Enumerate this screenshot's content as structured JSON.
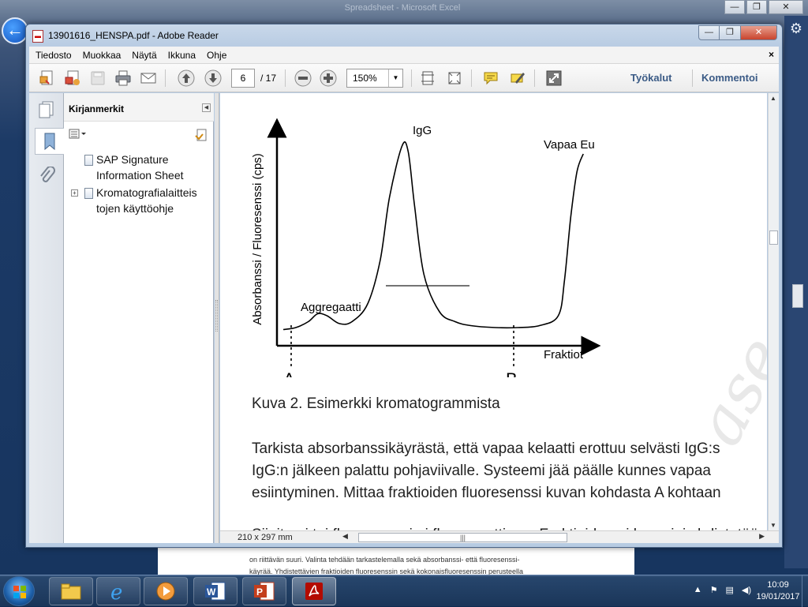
{
  "background": {
    "window_title": "Spreadsheet - Microsoft Excel",
    "peek_doc_lines": [
      "on riittävän suuri. Valinta tehdään tarkastelemalla sekä absorbanssi- että fluoresenssi-",
      "käyrää. Yhdistettävien fraktioiden fluoresenssin sekä kokonaisfluoresenssin perusteella"
    ]
  },
  "window": {
    "title": "13901616_HENSPA.pdf - Adobe Reader",
    "icon_name": "pdf-file-icon",
    "buttons": {
      "minimize": "—",
      "maximize": "❐",
      "close": "✕"
    }
  },
  "menubar": {
    "items": [
      "Tiedosto",
      "Muokkaa",
      "Näytä",
      "Ikkuna",
      "Ohje"
    ],
    "close_doc": "×"
  },
  "toolbar": {
    "page_current": "6",
    "page_total": "/ 17",
    "zoom": "150%",
    "tools_label": "Työkalut",
    "comment_label": "Kommentoi"
  },
  "bookmarks": {
    "title": "Kirjanmerkit",
    "items": [
      {
        "line1": "SAP Signature",
        "line2": "Information Sheet",
        "expandable": false
      },
      {
        "line1": "Kromatografialaitteis",
        "line2": "tojen käyttöohje",
        "expandable": true
      }
    ]
  },
  "document": {
    "caption": "Kuva 2. Esimerkki kromatogrammista",
    "paragraph": [
      "Tarkista absorbanssikäyrästä, että vapaa kelaatti erottuu selvästi IgG:s",
      "IgG:n jälkeen palattu pohjaviivalle. Systeemi jää päälle kunnes vapaa",
      "esiintyminen. Mittaa fraktioiden fluoresenssi kuvan kohdasta A kohtaan"
    ],
    "cut_line": "Sijoita ei tai fluoresenssi ei fluoresenttinen. Fraktioiden ei huomioi yhdistetään"
  },
  "chart_data": {
    "type": "line",
    "title": "",
    "xlabel": "Fraktiot",
    "ylabel": "Absorbanssi / Fluoresenssi (cps)",
    "annotations": [
      "IgG",
      "Vapaa Eu",
      "Aggregaatti"
    ],
    "markers": [
      "A",
      "B"
    ],
    "series": [
      {
        "x": [
          0,
          4,
          8,
          11,
          14,
          18,
          22,
          27,
          31,
          34,
          38,
          40,
          42,
          45,
          50,
          55,
          60,
          68,
          75,
          82,
          88,
          90,
          92,
          94,
          96
        ],
        "y": [
          5,
          6,
          9,
          13,
          12,
          8,
          9,
          18,
          40,
          72,
          98,
          95,
          68,
          33,
          14,
          9,
          7,
          6,
          6,
          7,
          12,
          30,
          62,
          85,
          94
        ]
      }
    ],
    "xlim": [
      0,
      100
    ],
    "ylim": [
      0,
      100
    ]
  },
  "statusbar": {
    "page_size": "210 x 297 mm"
  },
  "taskbar": {
    "apps": [
      "file-explorer-icon",
      "internet-explorer-icon",
      "media-player-icon",
      "word-icon",
      "powerpoint-icon",
      "acrobat-icon"
    ],
    "time": "10:09",
    "date": "19/01/2017"
  }
}
